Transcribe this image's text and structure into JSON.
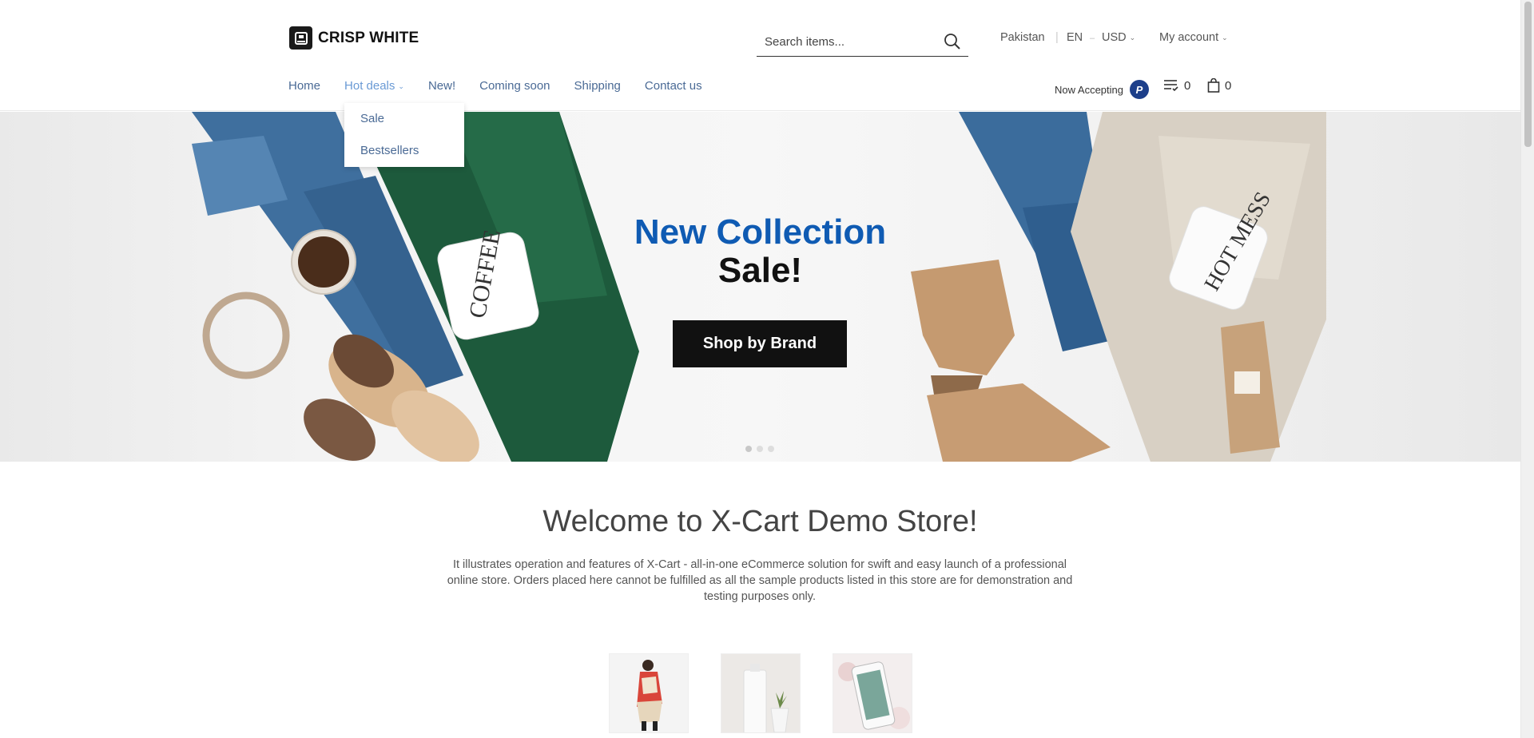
{
  "header": {
    "logo_text": "CRISP WHITE",
    "search_placeholder": "Search items...",
    "country": "Pakistan",
    "language": "EN",
    "currency": "USD",
    "account": "My account",
    "accepting_label": "Now Accepting",
    "compare_count": "0",
    "cart_count": "0"
  },
  "nav": {
    "items": [
      {
        "label": "Home"
      },
      {
        "label": "Hot deals"
      },
      {
        "label": "New!"
      },
      {
        "label": "Coming soon"
      },
      {
        "label": "Shipping"
      },
      {
        "label": "Contact us"
      }
    ]
  },
  "dropdown": {
    "items": [
      {
        "label": "Sale"
      },
      {
        "label": "Bestsellers"
      }
    ]
  },
  "hero": {
    "title": "New Collection",
    "subtitle": "Sale!",
    "button_label": "Shop by Brand"
  },
  "welcome": {
    "title": "Welcome to X-Cart Demo Store!",
    "text": "It illustrates operation and features of X-Cart - all-in-one eCommerce solution for swift and easy launch of a professional online store. Orders placed here cannot be fulfilled as all the sample products listed in this store are for demonstration and testing purposes only."
  },
  "colors": {
    "accent_blue": "#0f5bb3",
    "nav_link": "#4a6a95",
    "button_dark": "#111111"
  }
}
